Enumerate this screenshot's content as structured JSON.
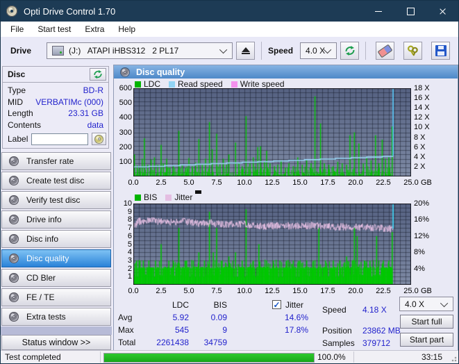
{
  "window": {
    "title": "Opti Drive Control 1.70"
  },
  "menu": {
    "items": [
      "File",
      "Start test",
      "Extra",
      "Help"
    ]
  },
  "toolbar": {
    "drive_label": "Drive",
    "drive_value": "(J:)   ATAPI iHBS312   2 PL17",
    "speed_label": "Speed",
    "speed_value": "4.0 X"
  },
  "disc_panel": {
    "title": "Disc",
    "rows": [
      {
        "label": "Type",
        "value": "BD-R"
      },
      {
        "label": "MID",
        "value": "VERBATIMc (000)"
      },
      {
        "label": "Length",
        "value": "23.31 GB"
      },
      {
        "label": "Contents",
        "value": "data"
      }
    ],
    "label_row": {
      "label": "Label",
      "input_value": ""
    }
  },
  "sidebar": {
    "items": [
      {
        "label": "Transfer rate",
        "selected": false
      },
      {
        "label": "Create test disc",
        "selected": false
      },
      {
        "label": "Verify test disc",
        "selected": false
      },
      {
        "label": "Drive info",
        "selected": false
      },
      {
        "label": "Disc info",
        "selected": false
      },
      {
        "label": "Disc quality",
        "selected": true
      },
      {
        "label": "CD Bler",
        "selected": false
      },
      {
        "label": "FE / TE",
        "selected": false
      },
      {
        "label": "Extra tests",
        "selected": false
      }
    ],
    "status_window_label": "Status window >>"
  },
  "content": {
    "header": "Disc quality"
  },
  "stats": {
    "col_ldc": "LDC",
    "col_bis": "BIS",
    "jitter_label": "Jitter",
    "jitter_checked": true,
    "rows": [
      {
        "label": "Avg",
        "ldc": "5.92",
        "bis": "0.09",
        "jitter": "14.6%"
      },
      {
        "label": "Max",
        "ldc": "545",
        "bis": "9",
        "jitter": "17.8%"
      },
      {
        "label": "Total",
        "ldc": "2261438",
        "bis": "34759",
        "jitter": ""
      }
    ],
    "speed_label": "Speed",
    "speed_value": "4.18 X",
    "position_label": "Position",
    "position_value": "23862 MB",
    "samples_label": "Samples",
    "samples_value": "379712",
    "speed_select": "4.0 X",
    "start_full_label": "Start full",
    "start_part_label": "Start part"
  },
  "statusbar": {
    "text": "Test completed",
    "progress": 100.0,
    "progress_label": "100.0%",
    "time": "33:15"
  },
  "chart_data": [
    {
      "type": "area",
      "title": "Disc quality - LDC vs Read speed",
      "legend": [
        "LDC",
        "Read speed",
        "Write speed"
      ],
      "legend_colors": [
        "#00b400",
        "#92d4f4",
        "#f490ec"
      ],
      "x_unit": "GB",
      "xlim": [
        0,
        25
      ],
      "x_ticks": [
        0,
        2.5,
        5,
        7.5,
        10,
        12.5,
        15,
        17.5,
        20,
        22.5,
        25
      ],
      "ylim_left": [
        0,
        600
      ],
      "y_ticks_left": [
        100,
        200,
        300,
        400,
        500,
        600
      ],
      "ylim_right": [
        0,
        18
      ],
      "y_ticks_right": [
        2,
        4,
        6,
        8,
        10,
        12,
        14,
        16,
        18
      ],
      "y_right_unit": " X",
      "grid": {
        "x_step_gb": 0.5,
        "y_step_left": 30
      },
      "data_end_gb": 23.35,
      "seed": 42,
      "colors": {
        "ldc": "#00c400",
        "read": "#9ad8f8",
        "end_spike": "#55c8f8",
        "bg_top": "#566282",
        "bg_bottom": "#7e8aa4",
        "grid": "rgba(12,16,30,0.42)",
        "border": "#14141c"
      },
      "ldc_baseline": {
        "min": 4,
        "max": 70
      },
      "ldc_spikes": [
        [
          0.1,
          150
        ],
        [
          0.35,
          75
        ],
        [
          0.6,
          60
        ],
        [
          0.8,
          120
        ],
        [
          1.0,
          260
        ],
        [
          1.3,
          80
        ],
        [
          1.6,
          115
        ],
        [
          1.9,
          130
        ],
        [
          2.2,
          80
        ],
        [
          2.5,
          215
        ],
        [
          2.7,
          90
        ],
        [
          3.0,
          120
        ],
        [
          3.3,
          60
        ],
        [
          3.6,
          70
        ],
        [
          4.1,
          310
        ],
        [
          4.4,
          75
        ],
        [
          4.7,
          60
        ],
        [
          5.0,
          125
        ],
        [
          5.3,
          70
        ],
        [
          5.6,
          95
        ],
        [
          5.9,
          255
        ],
        [
          6.2,
          80
        ],
        [
          6.5,
          120
        ],
        [
          6.85,
          370
        ],
        [
          7.1,
          185
        ],
        [
          7.5,
          290
        ],
        [
          7.8,
          90
        ],
        [
          8.1,
          120
        ],
        [
          8.4,
          80
        ],
        [
          8.6,
          150
        ],
        [
          9.2,
          230
        ],
        [
          9.5,
          90
        ],
        [
          9.8,
          70
        ],
        [
          10.15,
          410
        ],
        [
          10.5,
          90
        ],
        [
          10.8,
          130
        ],
        [
          11.2,
          200
        ],
        [
          11.45,
          205
        ],
        [
          11.8,
          100
        ],
        [
          12.0,
          175
        ],
        [
          12.3,
          90
        ],
        [
          12.7,
          70
        ],
        [
          13.0,
          80
        ],
        [
          13.3,
          110
        ],
        [
          13.7,
          60
        ],
        [
          14.0,
          90
        ],
        [
          14.4,
          70
        ],
        [
          14.8,
          130
        ],
        [
          15.2,
          80
        ],
        [
          15.6,
          110
        ],
        [
          16.0,
          90
        ],
        [
          16.35,
          545
        ],
        [
          16.85,
          360
        ],
        [
          17.2,
          90
        ],
        [
          17.6,
          80
        ],
        [
          18.0,
          70
        ],
        [
          18.4,
          100
        ],
        [
          18.8,
          90
        ],
        [
          19.2,
          80
        ],
        [
          19.5,
          280
        ],
        [
          19.9,
          300
        ],
        [
          20.3,
          225
        ],
        [
          20.7,
          90
        ],
        [
          21.0,
          130
        ],
        [
          21.4,
          110
        ],
        [
          21.8,
          280
        ],
        [
          22.1,
          90
        ],
        [
          22.4,
          250
        ],
        [
          22.7,
          120
        ],
        [
          23.0,
          130
        ],
        [
          23.3,
          340
        ]
      ],
      "read_speed_points": [
        [
          0,
          1.95
        ],
        [
          1.4,
          2.05
        ],
        [
          2.8,
          2.2
        ],
        [
          4.2,
          2.35
        ],
        [
          5.6,
          2.5
        ],
        [
          7.0,
          2.62
        ],
        [
          8.4,
          2.75
        ],
        [
          9.8,
          2.9
        ],
        [
          11.2,
          3.02
        ],
        [
          12.6,
          3.15
        ],
        [
          14.0,
          3.3
        ],
        [
          15.4,
          3.42
        ],
        [
          16.8,
          3.55
        ],
        [
          18.2,
          3.68
        ],
        [
          19.6,
          3.82
        ],
        [
          21.0,
          3.95
        ],
        [
          22.4,
          4.08
        ],
        [
          23.35,
          4.18
        ]
      ],
      "end_spike": {
        "x": 23.38,
        "from": 4.18,
        "to": 18
      }
    },
    {
      "type": "bar+line",
      "title": "Disc quality - BIS vs Jitter",
      "legend": [
        "BIS",
        "Jitter"
      ],
      "legend_colors": [
        "#00b400",
        "#e4bee2"
      ],
      "x_unit": "GB",
      "xlim": [
        0,
        25
      ],
      "x_ticks": [
        0,
        2.5,
        5,
        7.5,
        10,
        12.5,
        15,
        17.5,
        20,
        22.5,
        25
      ],
      "ylim_left": [
        0,
        10
      ],
      "y_ticks_left": [
        1,
        2,
        3,
        4,
        5,
        6,
        7,
        8,
        9,
        10
      ],
      "ylim_right": [
        0,
        20
      ],
      "y_ticks_right": [
        4,
        8,
        12,
        16,
        20
      ],
      "y_right_unit": "%",
      "grid": {
        "x_step_gb": 0.5,
        "y_step_left": 0.5
      },
      "data_end_gb": 23.35,
      "seed": 77,
      "colors": {
        "bis": "#00c800",
        "jitter": "#e4bee2",
        "end_line": "#38d6f6",
        "bg_top": "#566282",
        "bg_bottom": "#7e8aa4",
        "grid": "rgba(12,16,30,0.42)",
        "border": "#14141c"
      },
      "bis_baseline": {
        "low": 0.9,
        "mid": 2.0,
        "high": 3.1
      },
      "bis_spikes": [
        [
          0.3,
          3
        ],
        [
          0.6,
          3
        ],
        [
          0.9,
          3
        ],
        [
          1.4,
          3
        ],
        [
          2.0,
          3
        ],
        [
          2.5,
          5
        ],
        [
          3.2,
          3
        ],
        [
          3.6,
          3
        ],
        [
          4.1,
          7
        ],
        [
          4.8,
          3
        ],
        [
          5.4,
          3
        ],
        [
          5.9,
          4
        ],
        [
          6.4,
          3
        ],
        [
          6.85,
          9
        ],
        [
          7.2,
          4
        ],
        [
          7.5,
          7
        ],
        [
          8.0,
          3
        ],
        [
          8.6,
          3.5
        ],
        [
          9.2,
          4
        ],
        [
          9.8,
          3
        ],
        [
          10.15,
          9.3
        ],
        [
          10.8,
          3
        ],
        [
          11.3,
          5
        ],
        [
          12.0,
          3
        ],
        [
          12.6,
          3
        ],
        [
          13.2,
          3
        ],
        [
          13.8,
          3
        ],
        [
          14.4,
          3
        ],
        [
          15.0,
          3
        ],
        [
          15.6,
          3
        ],
        [
          16.2,
          3
        ],
        [
          16.7,
          7
        ],
        [
          17.3,
          3
        ],
        [
          18.0,
          3
        ],
        [
          18.6,
          3
        ],
        [
          19.2,
          3.5
        ],
        [
          19.9,
          7
        ],
        [
          20.15,
          6
        ],
        [
          20.8,
          3
        ],
        [
          21.3,
          3
        ],
        [
          21.9,
          6
        ],
        [
          22.5,
          3
        ],
        [
          23.0,
          3
        ],
        [
          23.3,
          6.5
        ]
      ],
      "jitter_trend": [
        [
          0,
          7.2
        ],
        [
          0.5,
          7.8
        ],
        [
          1.5,
          7.9
        ],
        [
          3,
          7.7
        ],
        [
          4.5,
          7.8
        ],
        [
          6,
          7.5
        ],
        [
          7,
          7.6
        ],
        [
          8,
          7.4
        ],
        [
          9,
          7.5
        ],
        [
          10,
          7.45
        ],
        [
          11,
          7.3
        ],
        [
          12,
          7.2
        ],
        [
          13,
          7.3
        ],
        [
          14,
          7.25
        ],
        [
          15,
          7.2
        ],
        [
          16,
          7.3
        ],
        [
          17,
          7.2
        ],
        [
          18,
          7.1
        ],
        [
          19,
          7.15
        ],
        [
          20,
          7.1
        ],
        [
          21,
          7.05
        ],
        [
          22,
          7.0
        ],
        [
          23,
          6.9
        ],
        [
          23.35,
          6.9
        ]
      ],
      "jitter_noise": 0.45,
      "end_line_x": 23.38
    }
  ]
}
